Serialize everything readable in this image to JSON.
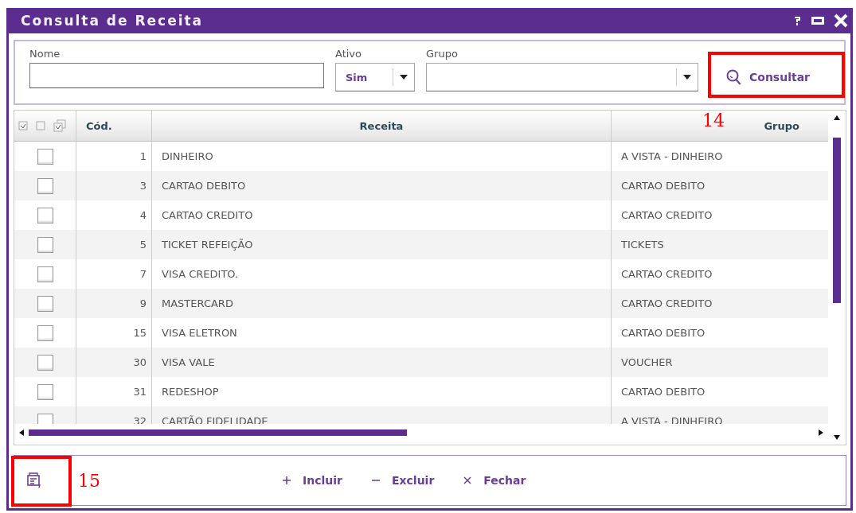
{
  "window": {
    "title": "Consulta de Receita"
  },
  "filters": {
    "nome": {
      "label": "Nome"
    },
    "ativo": {
      "label": "Ativo",
      "value": "Sim"
    },
    "grupo": {
      "label": "Grupo"
    },
    "search_button": "Consultar"
  },
  "table": {
    "columns": [
      "Cód.",
      "Receita",
      "Grupo"
    ],
    "rows": [
      {
        "checked": false,
        "code": "1",
        "receita": "DINHEIRO",
        "grupo": "A VISTA - DINHEIRO"
      },
      {
        "checked": false,
        "code": "3",
        "receita": "CARTAO DEBITO",
        "grupo": "CARTAO DEBITO"
      },
      {
        "checked": false,
        "code": "4",
        "receita": "CARTAO CREDITO",
        "grupo": "CARTAO CREDITO"
      },
      {
        "checked": false,
        "code": "5",
        "receita": "TICKET REFEIÇÃO",
        "grupo": "TICKETS"
      },
      {
        "checked": false,
        "code": "7",
        "receita": "VISA CREDITO.",
        "grupo": "CARTAO CREDITO"
      },
      {
        "checked": false,
        "code": "9",
        "receita": "MASTERCARD",
        "grupo": "CARTAO CREDITO"
      },
      {
        "checked": false,
        "code": "15",
        "receita": "VISA ELETRON",
        "grupo": "CARTAO DEBITO"
      },
      {
        "checked": false,
        "code": "30",
        "receita": "VISA VALE",
        "grupo": "VOUCHER"
      },
      {
        "checked": false,
        "code": "31",
        "receita": "REDESHOP",
        "grupo": "CARTAO DEBITO"
      },
      {
        "checked": false,
        "code": "32",
        "receita": "CARTÃO FIDELIDADE",
        "grupo": "A VISTA - DINHEIRO"
      }
    ]
  },
  "footer": {
    "buttons": [
      {
        "kind": "add",
        "label": "Incluir"
      },
      {
        "kind": "remove",
        "label": "Excluir"
      },
      {
        "kind": "close",
        "label": "Fechar"
      }
    ]
  },
  "annotations": [
    {
      "label": "14"
    },
    {
      "label": "15"
    }
  ]
}
